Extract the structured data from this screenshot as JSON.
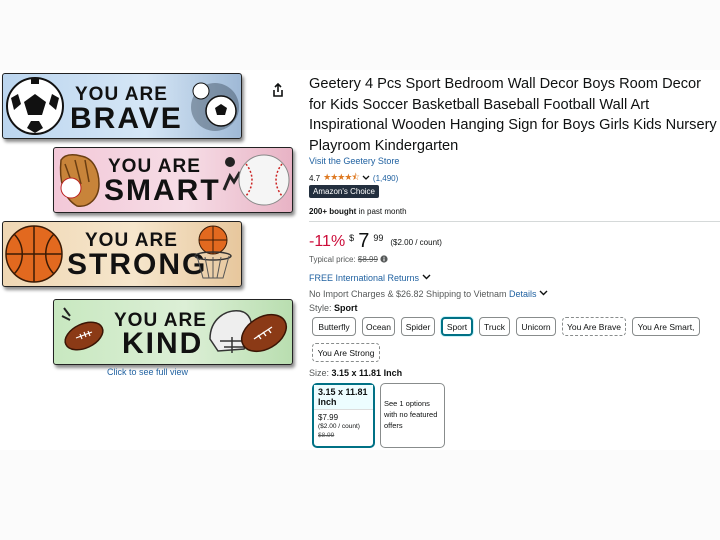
{
  "product": {
    "title": "Geetery 4 Pcs Sport Bedroom Wall Decor Boys Room Decor for Kids Soccer Basketball Baseball Football Wall Art Inspirational Wooden Hanging Sign for Boys Girls Kids Nursery Playroom Kindergarten",
    "store_link": "Visit the Geetery Store",
    "rating_value": "4.7",
    "stars": "★★★★⯪",
    "rating_count": "(1,490)",
    "badge": "Amazon's Choice",
    "bought_strong": "200+ bought",
    "bought_rest": " in past month"
  },
  "price": {
    "discount": "-11%",
    "symbol": "$",
    "whole": "7",
    "fraction": "99",
    "unit": "($2.00 / count)",
    "typical_label": "Typical price: ",
    "typical_value": "$8.99",
    "returns": "FREE International Returns",
    "ship_text": "No Import Charges & $26.82 Shipping to Vietnam ",
    "ship_link": "Details"
  },
  "style": {
    "label": "Style: ",
    "selected": "Sport",
    "options": [
      "Butterfly",
      "Ocean",
      "Spider",
      "Sport",
      "Truck",
      "Unicorn",
      "You Are Brave",
      "You Are Smart,",
      "You Are Strong"
    ]
  },
  "size": {
    "label": "Size: ",
    "selected": "3.15 x 11.81 Inch",
    "card_title": "3.15 x 11.81 Inch",
    "card_price": "$7.99",
    "card_unit": "($2.00 / count)",
    "card_old": "$8.99",
    "other_text": "See 1 options with no featured offers"
  },
  "gallery": {
    "signs": [
      {
        "line1": "YOU ARE",
        "line2": "BRAVE"
      },
      {
        "line1": "YOU ARE",
        "line2": "SMART"
      },
      {
        "line1": "YOU ARE",
        "line2": "STRONG"
      },
      {
        "line1": "YOU ARE",
        "line2": "KIND"
      }
    ],
    "full_view": "Click to see full view"
  },
  "colors": {
    "link": "#2162a1",
    "discount": "#cc0c39",
    "star": "#de7921",
    "badge_bg": "#232f3e",
    "selected_border": "#007185"
  },
  "icons": [
    "share-icon",
    "chevron-down-icon",
    "info-icon",
    "star-icon"
  ]
}
